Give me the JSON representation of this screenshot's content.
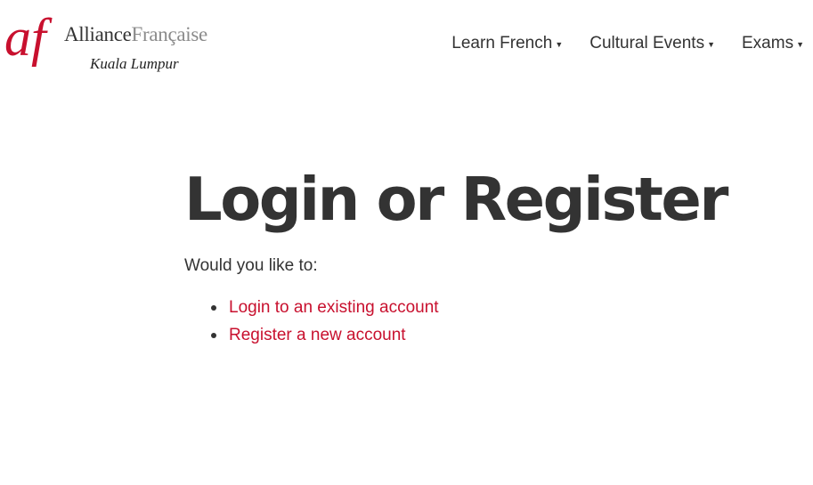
{
  "header": {
    "logo": {
      "mark": "af",
      "title_part1": "Alliance",
      "title_part2": "Française",
      "city": "Kuala Lumpur"
    },
    "nav": [
      {
        "label": "Learn French",
        "icon": "caret-down-icon"
      },
      {
        "label": "Cultural Events",
        "icon": "caret-down-icon"
      },
      {
        "label": "Exams",
        "icon": "caret-down-icon"
      }
    ]
  },
  "main": {
    "title": "Login or Register",
    "intro": "Would you like to:",
    "options": [
      {
        "label": "Login to an existing account"
      },
      {
        "label": "Register a new account"
      }
    ]
  },
  "colors": {
    "brand_red": "#c8102e",
    "text": "#333333",
    "logo_grey": "#8b8b8b",
    "background": "#ffffff"
  }
}
